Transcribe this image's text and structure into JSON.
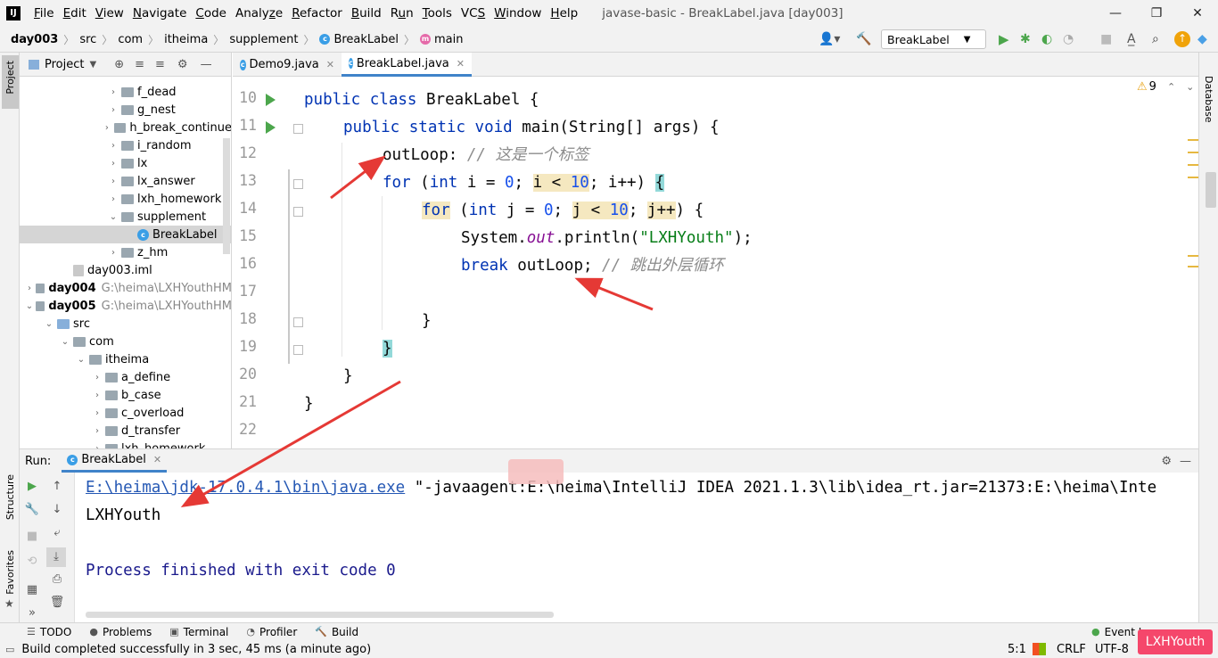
{
  "menu": {
    "app_icon": "IJ",
    "items": [
      "File",
      "Edit",
      "View",
      "Navigate",
      "Code",
      "Analyze",
      "Refactor",
      "Build",
      "Run",
      "Tools",
      "VCS",
      "Window",
      "Help"
    ],
    "mnemonics": [
      "F",
      "E",
      "V",
      "N",
      "C",
      "z",
      "R",
      "B",
      "u",
      "T",
      "S",
      "W",
      "H"
    ],
    "window_title": "javase-basic - BreakLabel.java [day003]"
  },
  "window_controls": {
    "minimize": "—",
    "restore": "❐",
    "close": "✕"
  },
  "breadcrumb": [
    "day003",
    "src",
    "com",
    "itheima",
    "supplement",
    "BreakLabel",
    "main"
  ],
  "toolbar": {
    "run_config": "BreakLabel"
  },
  "project": {
    "title": "Project",
    "tree": [
      {
        "label": "f_dead",
        "indent": 5,
        "arrow": "›",
        "icon": "folder"
      },
      {
        "label": "g_nest",
        "indent": 5,
        "arrow": "›",
        "icon": "folder"
      },
      {
        "label": "h_break_continue",
        "indent": 5,
        "arrow": "›",
        "icon": "folder"
      },
      {
        "label": "i_random",
        "indent": 5,
        "arrow": "›",
        "icon": "folder"
      },
      {
        "label": "lx",
        "indent": 5,
        "arrow": "›",
        "icon": "folder"
      },
      {
        "label": "lx_answer",
        "indent": 5,
        "arrow": "›",
        "icon": "folder"
      },
      {
        "label": "lxh_homework",
        "indent": 5,
        "arrow": "›",
        "icon": "folder"
      },
      {
        "label": "supplement",
        "indent": 5,
        "arrow": "⌄",
        "icon": "folder"
      },
      {
        "label": "BreakLabel",
        "indent": 6,
        "arrow": "",
        "icon": "class",
        "selected": true
      },
      {
        "label": "z_hm",
        "indent": 5,
        "arrow": "›",
        "icon": "folder"
      },
      {
        "label": "day003.iml",
        "indent": 2,
        "arrow": "",
        "icon": "file"
      },
      {
        "label": "day004",
        "indent": 0,
        "arrow": "›",
        "icon": "module",
        "path": "G:\\heima\\LXHYouthHM",
        "bold": true
      },
      {
        "label": "day005",
        "indent": 0,
        "arrow": "⌄",
        "icon": "module",
        "path": "G:\\heima\\LXHYouthHM",
        "bold": true
      },
      {
        "label": "src",
        "indent": 1,
        "arrow": "⌄",
        "icon": "src"
      },
      {
        "label": "com",
        "indent": 2,
        "arrow": "⌄",
        "icon": "folder"
      },
      {
        "label": "itheima",
        "indent": 3,
        "arrow": "⌄",
        "icon": "folder"
      },
      {
        "label": "a_define",
        "indent": 4,
        "arrow": "›",
        "icon": "folder"
      },
      {
        "label": "b_case",
        "indent": 4,
        "arrow": "›",
        "icon": "folder"
      },
      {
        "label": "c_overload",
        "indent": 4,
        "arrow": "›",
        "icon": "folder"
      },
      {
        "label": "d_transfer",
        "indent": 4,
        "arrow": "›",
        "icon": "folder"
      },
      {
        "label": "lxh_homework",
        "indent": 4,
        "arrow": "›",
        "icon": "folder"
      }
    ]
  },
  "tabs": [
    {
      "label": "Demo9.java",
      "active": false
    },
    {
      "label": "BreakLabel.java",
      "active": true
    }
  ],
  "editor": {
    "line_numbers": [
      "10",
      "11",
      "12",
      "13",
      "14",
      "15",
      "16",
      "17",
      "18",
      "19",
      "20",
      "21",
      "22"
    ],
    "lines": {
      "l10": {
        "kw1": "public",
        "kw2": "class",
        "name": "BreakLabel {"
      },
      "l11": {
        "kw1": "public",
        "kw2": "static",
        "kw3": "void",
        "rest": "main(String[] args) {"
      },
      "l12": {
        "label": "outLoop:",
        "comment": "// 这是一个标签"
      },
      "l13": {
        "kw": "for",
        "open": " (",
        "type": "int",
        "decl": " i = ",
        "zero": "0",
        "semi": "; ",
        "cond": "i < ",
        "ten": "10",
        "semi2": "; ",
        "inc": "i++",
        "close": ") ",
        "brace": "{"
      },
      "l14": {
        "kw": "for",
        "open": " (",
        "type": "int",
        "decl": " j = ",
        "zero": "0",
        "semi": "; ",
        "cond": "j < ",
        "ten": "10",
        "semi2": "; ",
        "inc": "j++",
        "close": ") {"
      },
      "l15": {
        "pre": "System.",
        "field": "out",
        "mid": ".println(",
        "str": "\"LXHYouth\"",
        "post": ");"
      },
      "l16": {
        "kw": "break",
        "label": " outLoop;",
        "comment": " // 跳出外层循环"
      },
      "l18": {
        "text": "}"
      },
      "l19": {
        "text": "}"
      },
      "l20": {
        "text": "}"
      },
      "l21": {
        "text": "}"
      }
    },
    "warnings": "9"
  },
  "side_labels": {
    "project": "Project",
    "structure": "Structure",
    "favorites": "Favorites",
    "database": "Database"
  },
  "run": {
    "label": "Run:",
    "tab": "BreakLabel",
    "console": {
      "java_path": "E:\\heima\\jdk-17.0.4.1\\bin\\java.exe",
      "args": " \"-javaagent:E:\\heima\\IntelliJ IDEA 2021.1.3\\lib\\idea_rt.jar=21373:E:\\heima\\Inte",
      "output": "LXHYouth",
      "finished": "Process finished with exit code 0"
    }
  },
  "bottom_tools": [
    "TODO",
    "Problems",
    "Terminal",
    "Profiler",
    "Build"
  ],
  "event_log": "Event Log",
  "status": {
    "message": "Build completed successfully in 3 sec, 45 ms (a minute ago)",
    "position": "5:1",
    "line_sep": "CRLF",
    "encoding": "UTF-8"
  },
  "watermark": "LXHYouth",
  "colors": {
    "accent": "#4083c9",
    "keyword": "#0033b3",
    "number": "#1750eb",
    "string": "#067d17",
    "annotation_arrow": "#e53935",
    "watermark": "#f5476b"
  }
}
